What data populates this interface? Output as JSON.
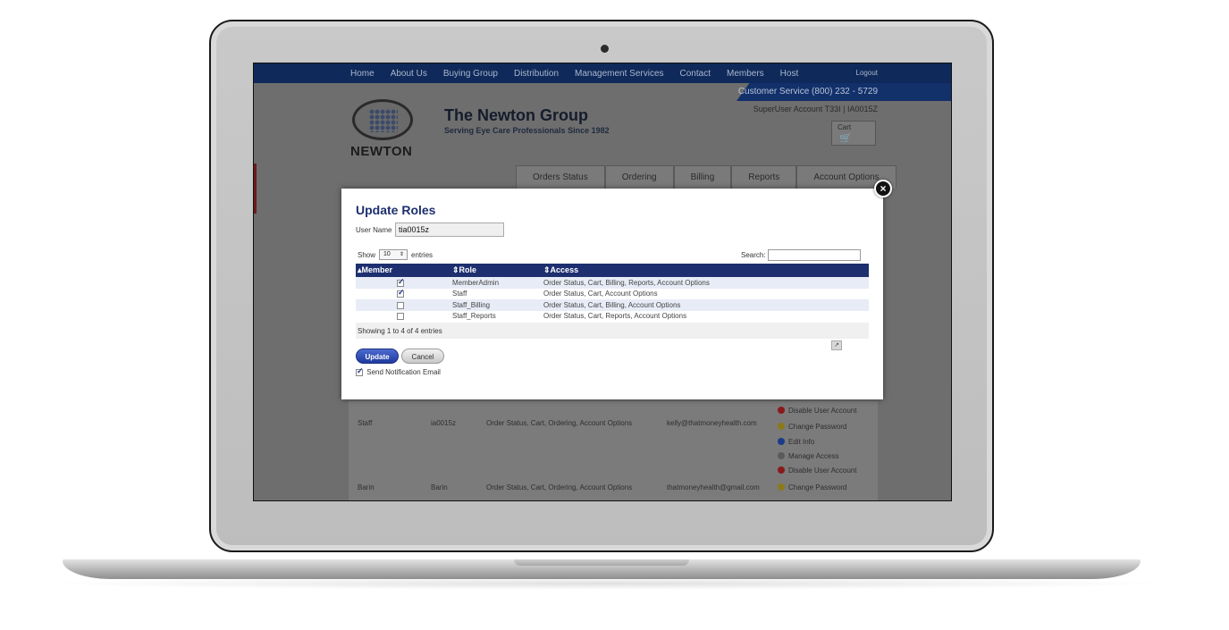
{
  "site": {
    "nav": [
      "Home",
      "About Us",
      "Buying Group",
      "Distribution",
      "Management Services",
      "Contact",
      "Members",
      "Host"
    ],
    "logout": "Logout",
    "customer_service": "Customer Service (800) 232 - 5729",
    "account": "SuperUser Account T33I | IA0015Z",
    "logo_word": "NEWTON",
    "company_name": "The Newton Group",
    "tagline": "Serving Eye Care Professionals Since 1982",
    "cart_label": "Cart",
    "subtabs": [
      "Orders Status",
      "Ordering",
      "Billing",
      "Reports",
      "Account Options"
    ],
    "bg_rows": [
      {
        "role": "Staff",
        "user": "ia0015z",
        "access": "Order Status, Cart, Ordering, Account Options",
        "email": "kelly@thatmoneyhealth.com"
      },
      {
        "role": "Barin",
        "user": "Barin",
        "access": "Order Status, Cart, Ordering, Account Options",
        "email": "thatmoneyhealth@gmail.com"
      }
    ],
    "bg_actions": [
      "Disable User Account",
      "Change Password",
      "Edit Info",
      "Manage Access",
      "Disable User Account",
      "Change Password"
    ]
  },
  "modal": {
    "title": "Update Roles",
    "username_label": "User Name",
    "username_value": "tia0015z",
    "show_label": "Show",
    "entries_value": "10",
    "entries_label": "entries",
    "search_label": "Search:",
    "columns": [
      "Member",
      "Role",
      "Access"
    ],
    "rows": [
      {
        "checked": true,
        "role": "MemberAdmin",
        "access": "Order Status, Cart, Billing, Reports, Account Options"
      },
      {
        "checked": true,
        "role": "Staff",
        "access": "Order Status, Cart, Account Options"
      },
      {
        "checked": false,
        "role": "Staff_Billing",
        "access": "Order Status, Cart, Billing, Account Options"
      },
      {
        "checked": false,
        "role": "Staff_Reports",
        "access": "Order Status, Cart, Reports, Account Options"
      }
    ],
    "showing_text": "Showing 1 to 4 of 4 entries",
    "update_label": "Update",
    "cancel_label": "Cancel",
    "notify_label": "Send Notification Email",
    "notify_checked": true
  },
  "colors": {
    "nav_bg": "#0f2a5a",
    "table_header": "#1d2f6e",
    "accent_blue": "#1f3a9e"
  }
}
